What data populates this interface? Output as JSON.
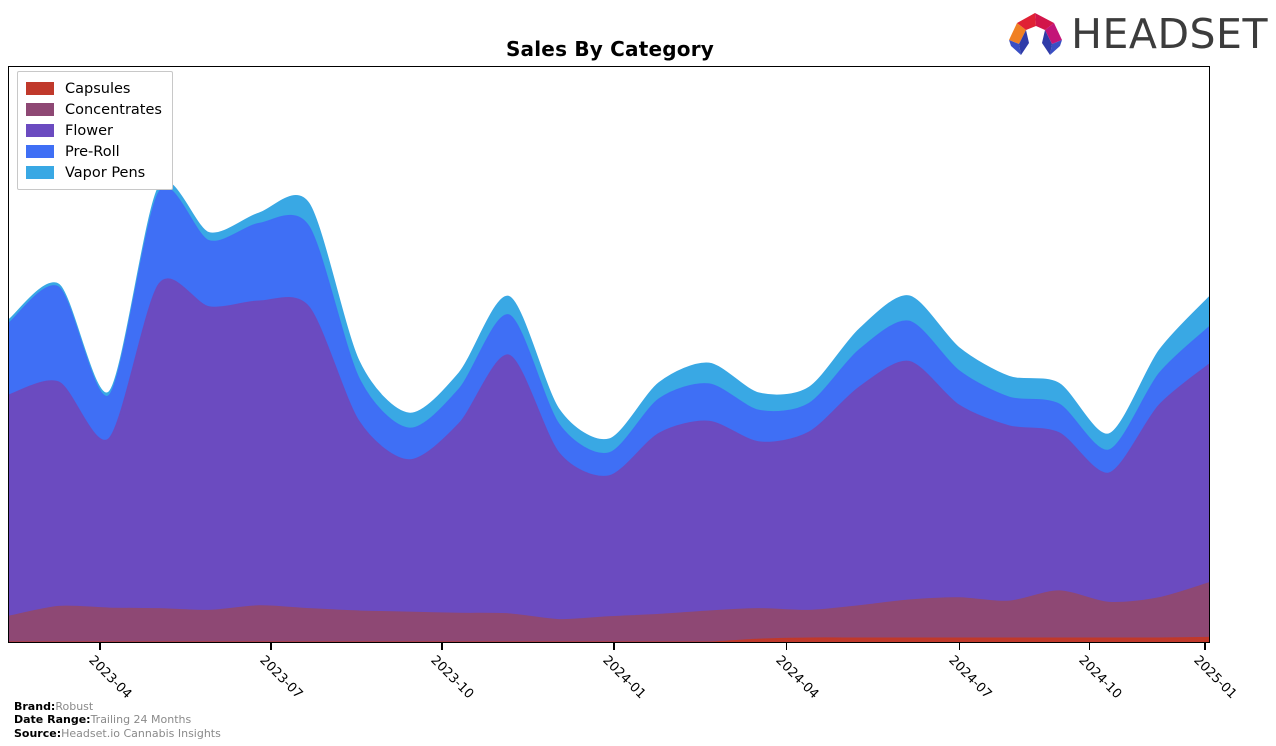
{
  "header": {
    "title": "Sales By Category",
    "logo_text": "HEADSET",
    "logo_colors": {
      "orange": "#F08023",
      "red": "#E02134",
      "crimson": "#D2154A",
      "magenta": "#C31578",
      "blue": "#3A4FC4",
      "indigo": "#2F3BA8"
    }
  },
  "legend": {
    "position": "top-left",
    "entries": [
      {
        "label": "Capsules",
        "color": "#C0392B"
      },
      {
        "label": "Concentrates",
        "color": "#8E4874"
      },
      {
        "label": "Flower",
        "color": "#6B4BC0"
      },
      {
        "label": "Pre-Roll",
        "color": "#3F6FF5"
      },
      {
        "label": "Vapor Pens",
        "color": "#39A8E4"
      }
    ]
  },
  "footer": {
    "rows": [
      {
        "key": "Brand:",
        "value": "Robust"
      },
      {
        "key": "Date Range:",
        "value": "Trailing 24 Months"
      },
      {
        "key": "Source:",
        "value": "Headset.io Cannabis Insights"
      }
    ]
  },
  "chart_data": {
    "type": "area",
    "stacked": true,
    "title": "Sales By Category",
    "xlabel": "",
    "ylabel": "",
    "grid": false,
    "legend_position": "top-left",
    "axis": {
      "x_tick_labels": [
        "2023-04",
        "2023-07",
        "2023-10",
        "2024-01",
        "2024-04",
        "2024-07",
        "2024-10",
        "2025-01"
      ],
      "x_tick_fractions": [
        0.0765,
        0.2188,
        0.3611,
        0.5042,
        0.6479,
        0.7917,
        0.9,
        0.9958
      ],
      "x_tick_rotation": 45,
      "y_axis_visible": false,
      "ylim": [
        0,
        100
      ]
    },
    "x": [
      "2023-01",
      "2023-02",
      "2023-03",
      "2023-04",
      "2023-05",
      "2023-06",
      "2023-07",
      "2023-08",
      "2023-09",
      "2023-10",
      "2023-11",
      "2023-12",
      "2024-01",
      "2024-02",
      "2024-03",
      "2024-04",
      "2024-05",
      "2024-06",
      "2024-07",
      "2024-08",
      "2024-09",
      "2024-10",
      "2024-11",
      "2024-12",
      "2025-01"
    ],
    "series": [
      {
        "name": "Capsules",
        "color": "#C0392B",
        "values": [
          0,
          0,
          0,
          0,
          0,
          0,
          0,
          0,
          0,
          0,
          0,
          0,
          0,
          0,
          0,
          0.5,
          0.7,
          0.7,
          0.7,
          0.7,
          0.7,
          0.7,
          0.7,
          0.7,
          0.8
        ]
      },
      {
        "name": "Concentrates",
        "color": "#8E4874",
        "values": [
          4.5,
          6.2,
          5.9,
          5.8,
          5.5,
          6.3,
          5.8,
          5.4,
          5.2,
          5.0,
          4.9,
          3.9,
          4.4,
          4.8,
          5.4,
          5.3,
          4.8,
          5.6,
          6.6,
          7.0,
          6.4,
          8.2,
          6.2,
          7.0,
          9.5
        ]
      },
      {
        "name": "Flower",
        "color": "#6B4BC0",
        "values": [
          38.5,
          39.0,
          29.5,
          56.5,
          52.8,
          53.0,
          52.5,
          33.0,
          26.5,
          33.0,
          45.0,
          29.0,
          24.5,
          31.5,
          33.0,
          29.0,
          31.0,
          38.0,
          41.5,
          33.5,
          30.5,
          27.5,
          22.5,
          33.5,
          38.0
        ]
      },
      {
        "name": "Pre-Roll",
        "color": "#3F6FF5",
        "values": [
          12.5,
          16.5,
          7.5,
          16.0,
          11.5,
          13.5,
          14.0,
          7.5,
          5.5,
          6.0,
          7.0,
          5.0,
          4.0,
          6.0,
          6.5,
          5.5,
          5.0,
          6.5,
          7.0,
          6.0,
          5.0,
          5.0,
          4.0,
          5.5,
          6.5
        ]
      },
      {
        "name": "Vapor Pens",
        "color": "#39A8E4",
        "values": [
          0.6,
          0.5,
          0.6,
          1.0,
          1.4,
          1.8,
          4.0,
          3.0,
          2.6,
          2.8,
          3.2,
          2.6,
          2.4,
          2.8,
          3.6,
          3.0,
          2.8,
          3.6,
          4.4,
          4.0,
          3.6,
          3.6,
          2.8,
          4.0,
          5.2
        ]
      }
    ]
  }
}
